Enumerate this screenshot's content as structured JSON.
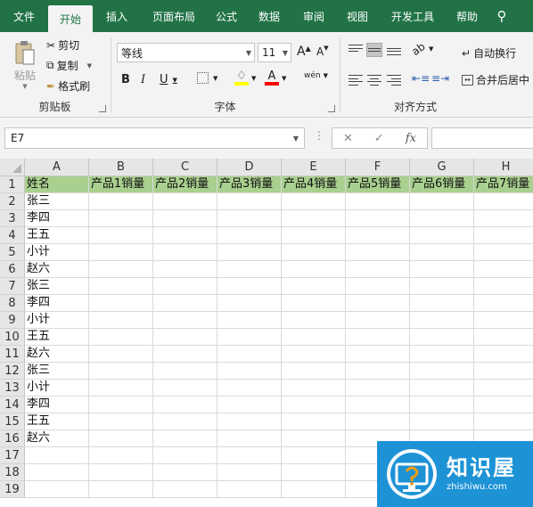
{
  "tabs": [
    "文件",
    "开始",
    "插入",
    "页面布局",
    "公式",
    "数据",
    "审阅",
    "视图",
    "开发工具",
    "帮助"
  ],
  "ribbon": {
    "clipboard": {
      "paste": "粘贴",
      "cut": "剪切",
      "copy": "复制",
      "format_painter": "格式刷",
      "label": "剪贴板"
    },
    "font": {
      "name": "等线",
      "size": "11",
      "grow": "A",
      "shrink": "A",
      "bold": "B",
      "italic": "I",
      "underline": "U",
      "font_color": "A",
      "phonetic": "wén",
      "label": "字体",
      "fill_color": "#ffff00",
      "text_color": "#ff0000"
    },
    "alignment": {
      "wrap_text": "自动换行",
      "merge_center": "合并后居中",
      "label": "对齐方式"
    }
  },
  "formula_bar": {
    "name_box": "E7",
    "cancel": "✕",
    "enter": "✓",
    "fx": "fx",
    "value": ""
  },
  "sheet": {
    "columns": [
      "A",
      "B",
      "C",
      "D",
      "E",
      "F",
      "G",
      "H"
    ],
    "row_numbers": [
      "1",
      "2",
      "3",
      "4",
      "5",
      "6",
      "7",
      "8",
      "9",
      "10",
      "11",
      "12",
      "13",
      "14",
      "15",
      "16",
      "17",
      "18",
      "19"
    ],
    "header_row": [
      "姓名",
      "产品1销量",
      "产品2销量",
      "产品3销量",
      "产品4销量",
      "产品5销量",
      "产品6销量",
      "产品7销量"
    ],
    "names": [
      "张三",
      "李四",
      "王五",
      "小计",
      "赵六",
      "张三",
      "李四",
      "小计",
      "王五",
      "赵六",
      "张三",
      "小计",
      "李四",
      "王五",
      "赵六"
    ],
    "header_color": "#a9d08e"
  },
  "watermark": {
    "title": "知识屋",
    "subtitle": "zhishiwu.com",
    "bg_color": "#1d93d6"
  }
}
